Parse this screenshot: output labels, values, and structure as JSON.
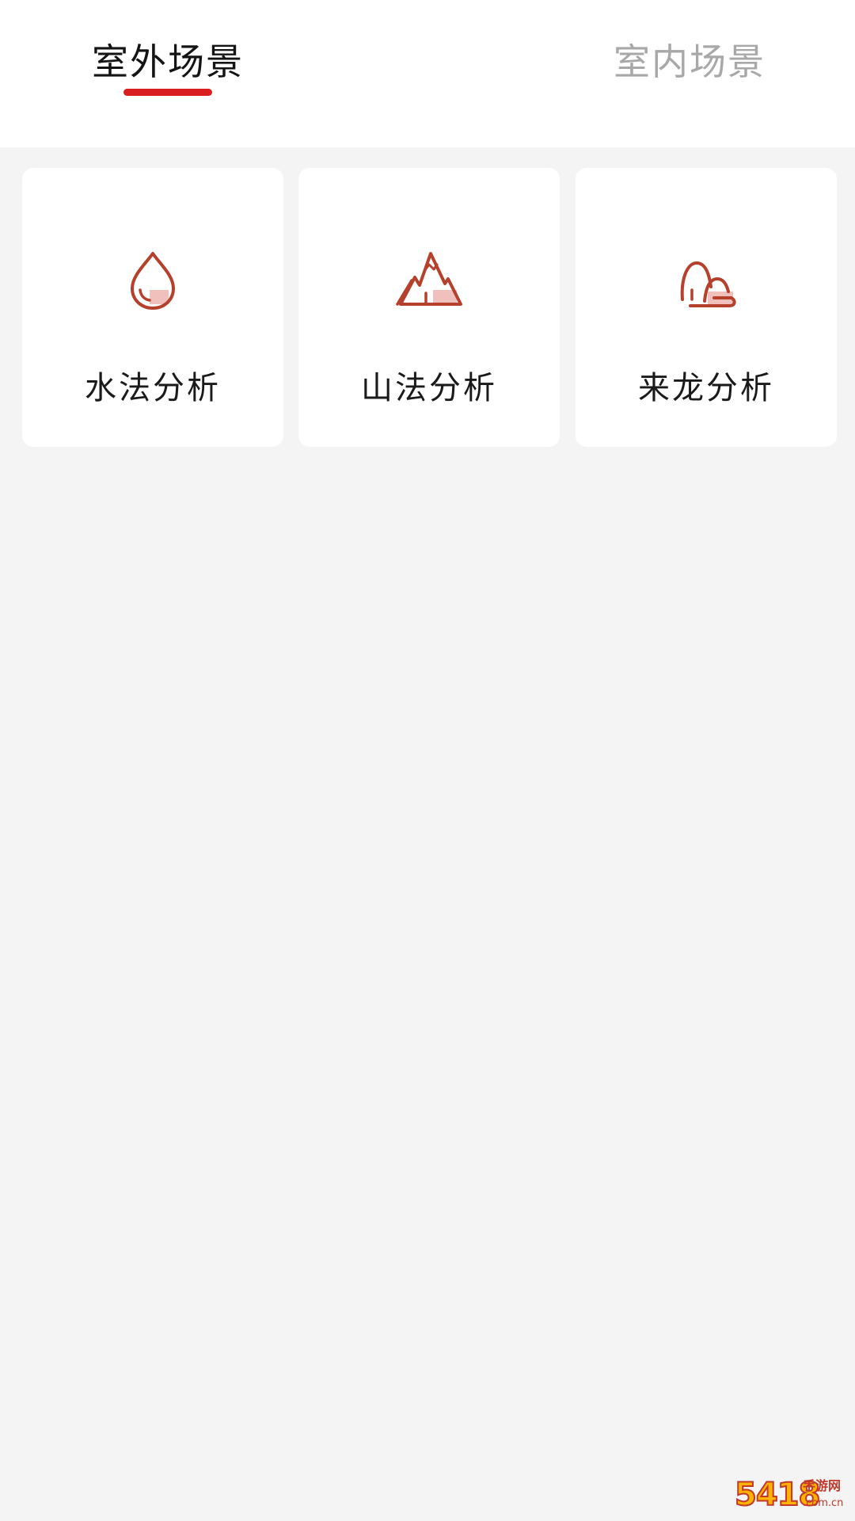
{
  "tabs": [
    {
      "label": "室外场景",
      "active": true
    },
    {
      "label": "室内场景",
      "active": false
    }
  ],
  "cards": [
    {
      "label": "水法分析",
      "icon": "water-drop-icon"
    },
    {
      "label": "山法分析",
      "icon": "mountain-icon"
    },
    {
      "label": "来龙分析",
      "icon": "dragon-ridge-icon"
    }
  ],
  "watermark": {
    "main": "5418",
    "side": "手游网",
    "domain": ".com.cn"
  },
  "colors": {
    "accent": "#d81e1e",
    "icon_stroke": "#b5402c",
    "icon_fill": "#f0c0bc",
    "page_bg": "#f4f4f4"
  }
}
